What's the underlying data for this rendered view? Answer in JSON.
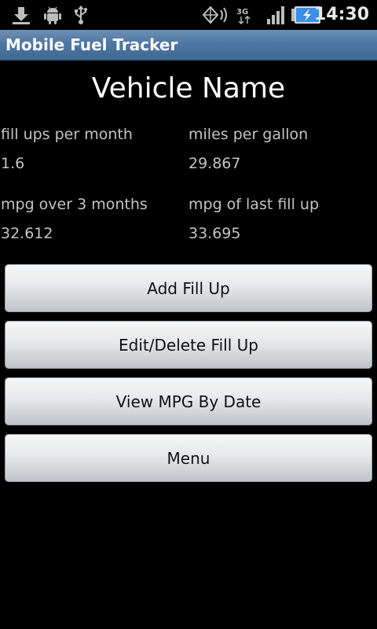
{
  "status_bar": {
    "time": "14:30",
    "network_label": "3G",
    "icons": [
      "download-icon",
      "android-debug-icon",
      "usb-icon",
      "gps-icon",
      "3g-icon",
      "signal-icon",
      "battery-charging-icon"
    ]
  },
  "app": {
    "title": "Mobile Fuel Tracker"
  },
  "vehicle": {
    "name": "Vehicle Name"
  },
  "stats": {
    "fill_ups_label": "fill ups per month",
    "fill_ups_value": "1.6",
    "mpg_label": "miles per gallon",
    "mpg_value": "29.867",
    "mpg_3mo_label": "mpg over 3 months",
    "mpg_3mo_value": "32.612",
    "mpg_last_label": "mpg of last fill up",
    "mpg_last_value": "33.695"
  },
  "buttons": {
    "add": "Add Fill Up",
    "edit": "Edit/Delete Fill Up",
    "view": "View MPG By Date",
    "menu": "Menu"
  },
  "colors": {
    "title_bar": "#4f77a3",
    "background": "#000000",
    "battery_fill": "#3a8fe8"
  }
}
